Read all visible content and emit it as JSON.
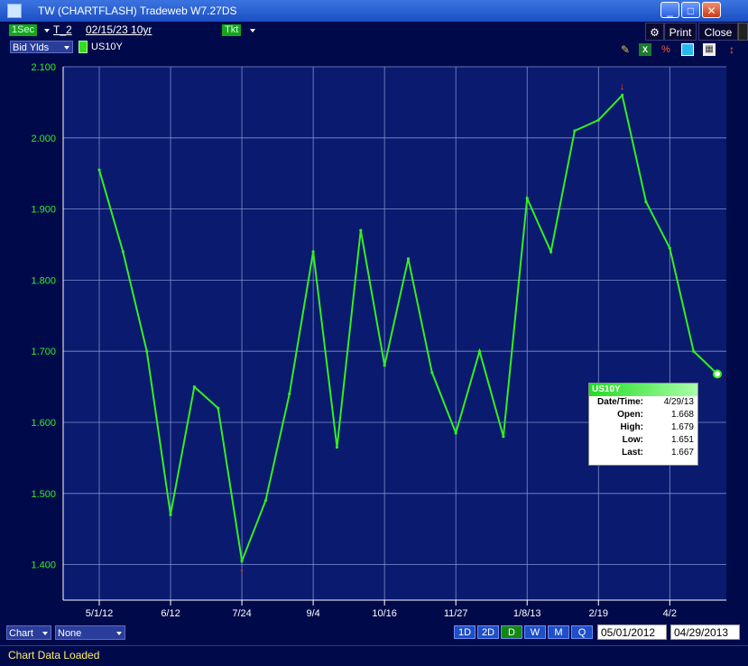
{
  "window": {
    "title": "TW  (CHARTFLASH) Tradeweb W7.27DS"
  },
  "toolbar": {
    "interval": "1Sec",
    "instrument_prefix": "T_2",
    "instrument": "02/15/23 10yr",
    "ticket": "Tkt",
    "print": "Print",
    "close": "Close",
    "yield_type": "Bid Ylds",
    "legend_series": "US10Y"
  },
  "colors": {
    "series": "#33ee22",
    "background": "#000a4a",
    "axis_text": "#33ee22"
  },
  "chart_data": {
    "type": "line",
    "series": [
      {
        "name": "US10Y"
      }
    ],
    "ylim": [
      1.35,
      2.1
    ],
    "y_ticks": [
      "2.100",
      "2.000",
      "1.900",
      "1.800",
      "1.700",
      "1.600",
      "1.500",
      "1.400"
    ],
    "x_ticks": [
      "5/1/12",
      "6/12",
      "7/24",
      "9/4",
      "10/16",
      "11/27",
      "1/8/13",
      "2/19",
      "4/2"
    ],
    "x": [
      "5/1/12",
      "5/15/12",
      "6/1/12",
      "6/12",
      "6/26",
      "7/10",
      "7/24",
      "8/7",
      "8/21",
      "9/4",
      "9/18",
      "10/2",
      "10/16",
      "10/30",
      "11/13",
      "11/27",
      "12/11",
      "12/25",
      "1/8/13",
      "1/22",
      "2/5",
      "2/19",
      "3/5",
      "3/19",
      "4/2",
      "4/16",
      "4/29/13"
    ],
    "values": [
      1.955,
      1.84,
      1.7,
      1.47,
      1.65,
      1.62,
      1.405,
      1.49,
      1.64,
      1.84,
      1.565,
      1.87,
      1.68,
      1.83,
      1.67,
      1.585,
      1.7,
      1.58,
      1.915,
      1.84,
      2.01,
      2.025,
      2.06,
      1.91,
      1.845,
      1.7,
      1.668
    ],
    "markers": [
      {
        "type": "high",
        "x": "3/5",
        "value": 2.06
      },
      {
        "type": "low",
        "x": "7/24",
        "value": 1.405
      }
    ]
  },
  "tooltip": {
    "title": "US10Y",
    "date_label": "Date/Time:",
    "date": "4/29/13",
    "open_label": "Open:",
    "open": "1.668",
    "high_label": "High:",
    "high": "1.679",
    "low_label": "Low:",
    "low": "1.651",
    "last_label": "Last:",
    "last": "1.667"
  },
  "bottom": {
    "chart_select": "Chart",
    "study_select": "None",
    "ranges": [
      "1D",
      "2D",
      "D",
      "W",
      "M",
      "Q"
    ],
    "active_range": "D",
    "start_date": "05/01/2012",
    "end_date": "04/29/2013"
  },
  "status": {
    "message": "Chart Data Loaded"
  }
}
